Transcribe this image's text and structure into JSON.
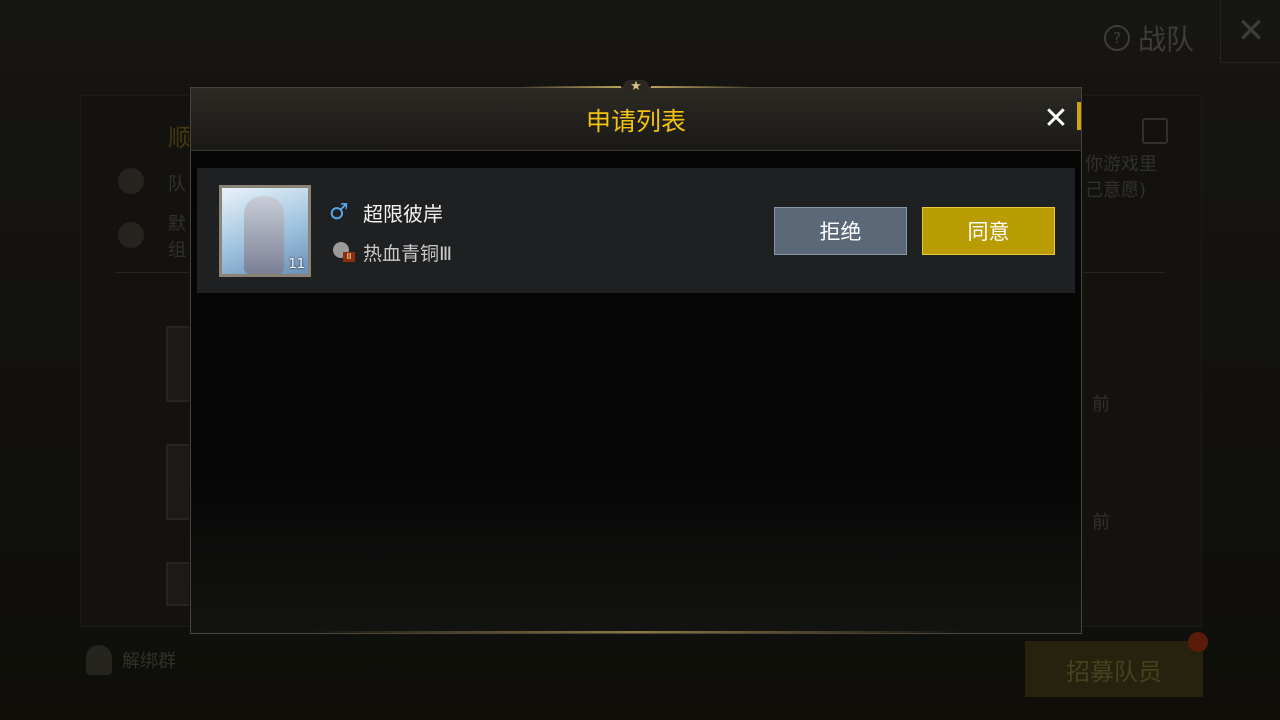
{
  "background": {
    "help_label": "战队",
    "help_icon": "?",
    "close_icon": "✕",
    "left_name": "顺",
    "side_labels": [
      "队",
      "默",
      "组"
    ],
    "right_texts": [
      "你游戏里",
      "己意愿)"
    ],
    "time_labels": [
      "前",
      "前"
    ],
    "unbind_label": "解绑群",
    "recruit_button": "招募队员"
  },
  "modal": {
    "title": "申请列表",
    "close_icon": "✕",
    "star_icon": "★"
  },
  "applicants": [
    {
      "gender_icon": "♂",
      "name": "超限彼岸",
      "avatar_level": "11",
      "rank": "热血青铜Ⅲ",
      "rank_badge": "Ⅲ",
      "reject_label": "拒绝",
      "accept_label": "同意"
    }
  ],
  "colors": {
    "title": "#f3c20e",
    "accept": "#b99b02",
    "reject": "#5b6877",
    "gender_male": "#55a8ee"
  }
}
